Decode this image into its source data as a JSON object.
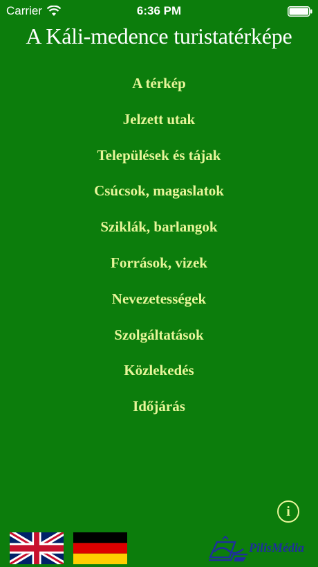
{
  "status_bar": {
    "carrier": "Carrier",
    "time": "6:36 PM",
    "icons": [
      "wifi-icon",
      "battery-icon"
    ]
  },
  "title": "A Káli-medence turistatérképe",
  "menu": {
    "items": [
      {
        "label": "A térkép"
      },
      {
        "label": "Jelzett utak"
      },
      {
        "label": "Települések és tájak"
      },
      {
        "label": "Csúcsok, magaslatok"
      },
      {
        "label": "Sziklák, barlangok"
      },
      {
        "label": "Források, vizek"
      },
      {
        "label": "Nevezetességek"
      },
      {
        "label": "Szolgáltatások"
      },
      {
        "label": "Közlekedés"
      },
      {
        "label": "Időjárás"
      }
    ]
  },
  "info_button": {
    "icon": "info-icon",
    "label": "i"
  },
  "flags": [
    {
      "icon": "uk-flag-icon"
    },
    {
      "icon": "german-flag-icon"
    }
  ],
  "brand": {
    "name": "PilisMédia",
    "icon": "pilismedia-logo-icon"
  },
  "colors": {
    "background": "#0c7d0c",
    "menu_text": "#e8f59a",
    "title_text": "#ffffff",
    "brand_text": "#1e2f9c"
  }
}
